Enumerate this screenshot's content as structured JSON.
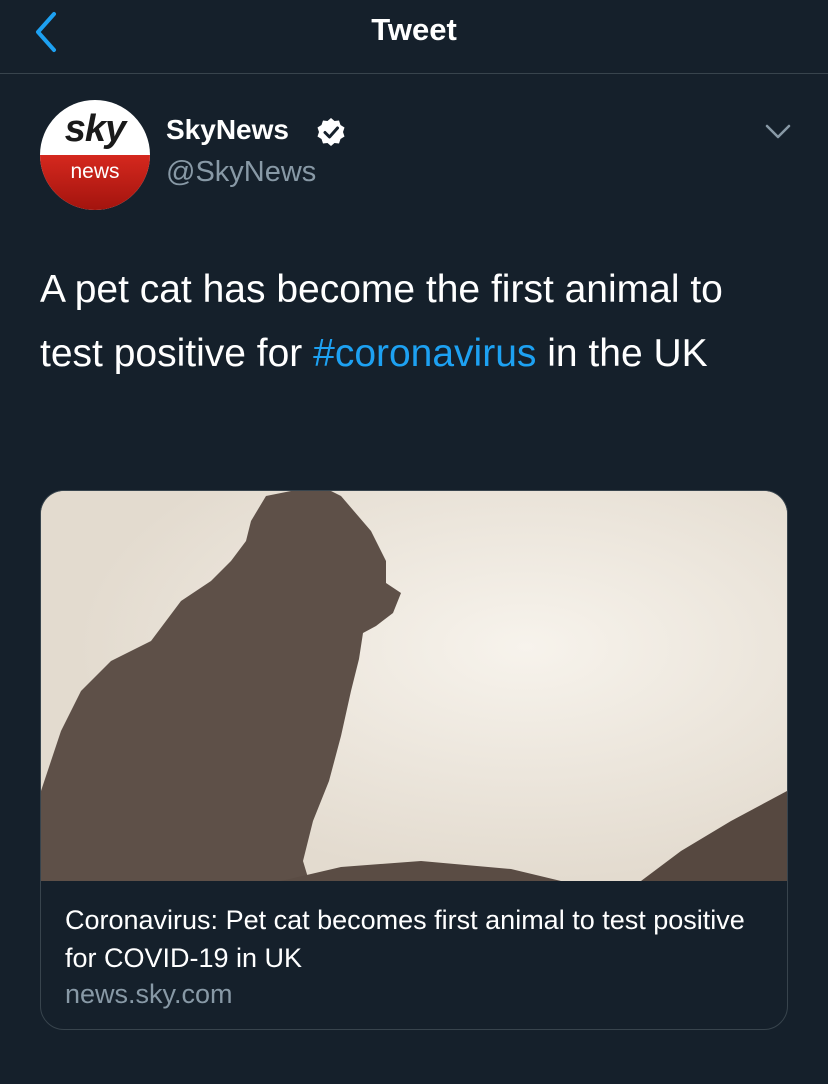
{
  "nav": {
    "title": "Tweet"
  },
  "account": {
    "avatar_top": "sky",
    "avatar_bottom": "news",
    "display_name": "SkyNews",
    "handle": "@SkyNews"
  },
  "tweet": {
    "text_before": "A pet cat has become the first animal to test positive for ",
    "hashtag": "#coronavirus",
    "text_after": " in the UK"
  },
  "card": {
    "title": "Coronavirus: Pet cat becomes first animal to test positive for COVID-19 in UK",
    "domain": "news.sky.com"
  },
  "colors": {
    "background": "#15202b",
    "accent": "#1da1f2",
    "secondary_text": "#8899a6",
    "divider": "#38444d",
    "brand_red": "#d5281e"
  },
  "icons": {
    "back": "chevron-left-icon",
    "verified": "verified-badge-icon",
    "menu": "chevron-down-icon"
  }
}
